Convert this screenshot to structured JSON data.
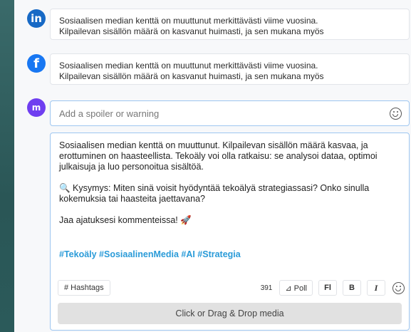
{
  "previews": [
    {
      "network_icon": "linkedin-icon",
      "line1": "Sosiaalisen median kenttä on muuttunut merkittävästi viime vuosina.",
      "line2": "Kilpailevan sisällön määrä on kasvanut huimasti, ja sen mukana myös"
    },
    {
      "network_icon": "facebook-icon",
      "line1": "Sosiaalisen median kenttä on muuttunut merkittävästi viime vuosina.",
      "line2": "Kilpailevan sisällön määrä on kasvanut huimasti, ja sen mukana myös"
    }
  ],
  "mastodon": {
    "network_icon": "mastodon-icon",
    "spoiler_placeholder": "Add a spoiler or warning"
  },
  "composer": {
    "paragraph1": "Sosiaalisen median kenttä on muuttunut. Kilpailevan sisällön määrä kasvaa, ja erottuminen on haasteellista. Tekoäly voi olla ratkaisu: se analysoi dataa, optimoi julkaisuja ja luo personoitua sisältöä.",
    "paragraph2": "🔍 Kysymys: Miten sinä voisit hyödyntää tekoälyä strategiassasi? Onko sinulla kokemuksia tai haasteita jaettavana?",
    "paragraph3": "Jaa ajatuksesi kommenteissa! 🚀",
    "hashtags": "#Tekoäly #SosiaalinenMedia #AI #Strategia"
  },
  "toolbar": {
    "hashtags_label": "# Hashtags",
    "char_count": "391",
    "poll_label": "⊿ Poll",
    "fl_label": "Fl",
    "bold_label": "B",
    "italic_label": "I"
  },
  "dropzone_label": "Click or Drag & Drop media",
  "colors": {
    "linkedin": "#1769c5",
    "facebook": "#1877f2",
    "mastodon": "#6f3ef0",
    "hashtag": "#2a9bd8",
    "focus_border": "#9ec6f0"
  }
}
